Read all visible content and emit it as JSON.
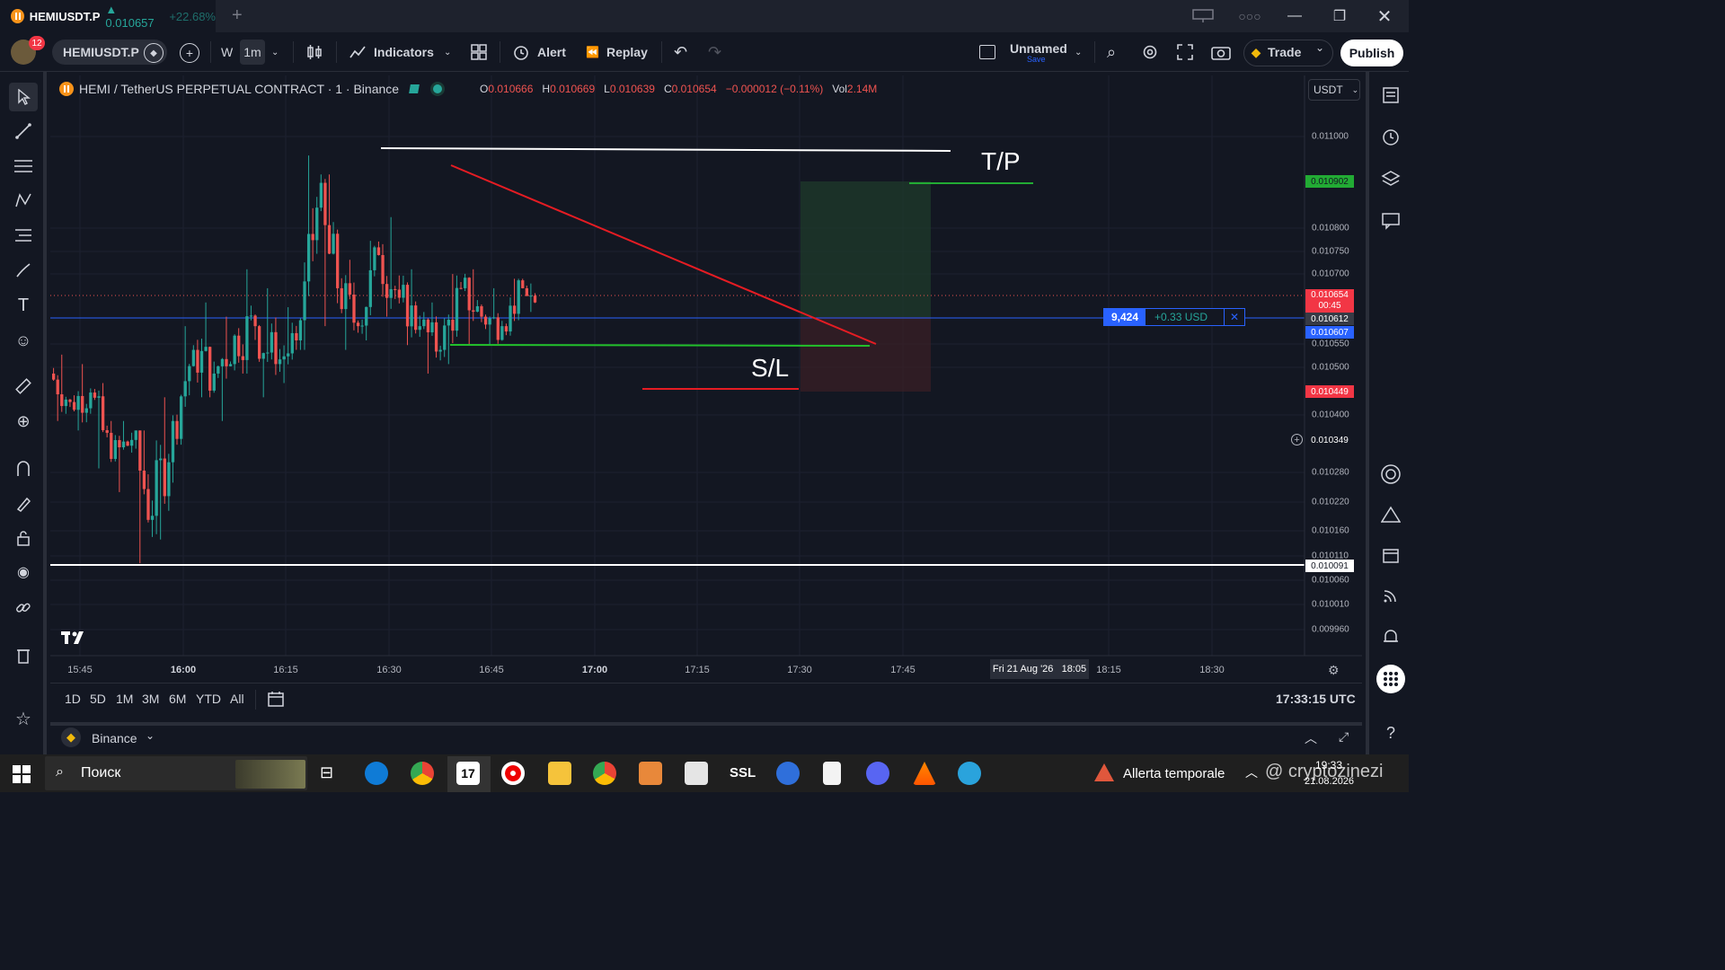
{
  "titlebar": {
    "tab_symbol": "HEMIUSDT.P",
    "tab_price": "▲ 0.010657",
    "tab_change": "+22.68%",
    "new_tab": "+"
  },
  "toolbar": {
    "notif_count": "12",
    "symbol": "HEMIUSDT.P",
    "interval_w": "W",
    "interval_active": "1m",
    "indicators": "Indicators",
    "alert": "Alert",
    "replay": "Replay",
    "layout_name": "Unnamed",
    "layout_save": "Save",
    "trade": "Trade",
    "publish": "Publish"
  },
  "legend": {
    "title": "HEMI / TetherUS PERPETUAL CONTRACT · 1 · Binance",
    "open_label": "O",
    "open": "0.010666",
    "high_label": "H",
    "high": "0.010669",
    "low_label": "L",
    "low": "0.010639",
    "close_label": "C",
    "close": "0.010654",
    "change": "−0.000012 (−0.11%)",
    "vol_label": "Vol",
    "vol": "2.14M"
  },
  "currency_select": "USDT",
  "annotations": {
    "tp": "T/P",
    "sl": "S/L"
  },
  "position_order": {
    "qty": "9,424",
    "pnl": "+0.33 USD",
    "close": "✕"
  },
  "price_scale": {
    "labels": [
      "0.011000",
      "0.010800",
      "0.010750",
      "0.010700",
      "0.010550",
      "0.010500",
      "0.010400",
      "0.010280",
      "0.010220",
      "0.010160",
      "0.010110",
      "0.010060",
      "0.010010",
      "0.009960"
    ],
    "tags": {
      "tp": "0.010902",
      "last": "0.010654",
      "countdown": "00:45",
      "entry": "0.010612",
      "blue": "0.010607",
      "sl": "0.010449",
      "crosshair": "0.010349",
      "white": "0.010091"
    }
  },
  "time_scale": {
    "labels": [
      "15:45",
      "16:00",
      "16:15",
      "16:30",
      "16:45",
      "17:00",
      "17:15",
      "17:30",
      "17:45",
      "18:15",
      "18:30"
    ],
    "crosshair": "Fri 21 Aug '26   18:05"
  },
  "bottombar": {
    "ranges": [
      "1D",
      "5D",
      "1M",
      "3M",
      "6M",
      "YTD",
      "All"
    ],
    "clock": "17:33:15 UTC"
  },
  "panel": {
    "exchange": "Binance"
  },
  "taskbar": {
    "search": "Поиск",
    "weather": "Allerta temporale",
    "time": "19:33",
    "date": "21.08.2026",
    "watermark": "@ cryptozinezi"
  },
  "colors": {
    "bg": "#131722",
    "up": "#26a69a",
    "down": "#ef5350",
    "accent_blue": "#2962ff"
  },
  "chart_data": {
    "type": "candlestick",
    "symbol": "HEMIUSDT.P",
    "interval": "1",
    "ylim": [
      0.00993,
      0.01105
    ],
    "x": [
      "15:40",
      "15:45",
      "15:50",
      "15:55",
      "16:00",
      "16:05",
      "16:10",
      "16:15",
      "16:20",
      "16:25",
      "16:30",
      "16:35",
      "16:40",
      "16:45",
      "16:50",
      "16:55",
      "17:00",
      "17:05",
      "17:10",
      "17:15",
      "17:20",
      "17:25",
      "17:30",
      "17:32"
    ],
    "ohlc": [
      [
        0.0105,
        0.01054,
        0.0104,
        0.01044
      ],
      [
        0.01044,
        0.01052,
        0.01038,
        0.01046
      ],
      [
        0.01046,
        0.01048,
        0.0103,
        0.01032
      ],
      [
        0.01032,
        0.0104,
        0.01025,
        0.01036
      ],
      [
        0.01036,
        0.01038,
        0.0101,
        0.0102
      ],
      [
        0.0102,
        0.01045,
        0.01015,
        0.0104
      ],
      [
        0.0104,
        0.0106,
        0.01035,
        0.01055
      ],
      [
        0.01055,
        0.01065,
        0.01045,
        0.0105
      ],
      [
        0.0105,
        0.01062,
        0.0104,
        0.01058
      ],
      [
        0.01058,
        0.01072,
        0.0105,
        0.0106
      ],
      [
        0.0106,
        0.01068,
        0.01045,
        0.01052
      ],
      [
        0.01052,
        0.01064,
        0.01048,
        0.01057
      ],
      [
        0.01057,
        0.01096,
        0.01055,
        0.01085
      ],
      [
        0.01085,
        0.01092,
        0.0106,
        0.01068
      ],
      [
        0.01068,
        0.01074,
        0.01055,
        0.0106
      ],
      [
        0.0106,
        0.01078,
        0.01057,
        0.01075
      ],
      [
        0.01075,
        0.01083,
        0.01062,
        0.01066
      ],
      [
        0.01066,
        0.01072,
        0.01056,
        0.0106
      ],
      [
        0.0106,
        0.01065,
        0.0105,
        0.01055
      ],
      [
        0.01055,
        0.01071,
        0.01052,
        0.01068
      ],
      [
        0.01068,
        0.01072,
        0.01056,
        0.01062
      ],
      [
        0.01062,
        0.01068,
        0.01056,
        0.0106
      ],
      [
        0.0106,
        0.0107,
        0.01058,
        0.01068
      ],
      [
        0.01068,
        0.01069,
        0.01063,
        0.01065
      ]
    ],
    "horizontal_lines": [
      0.01103,
      0.010091,
      0.010607,
      0.010555,
      0.010449,
      0.010902
    ],
    "trendline": [
      [
        "16:44",
        0.01093
      ],
      [
        "17:37",
        0.01055
      ]
    ],
    "position": {
      "side": "long",
      "entry": 0.010612,
      "take_profit": 0.010902,
      "stop_loss": 0.010449
    }
  }
}
